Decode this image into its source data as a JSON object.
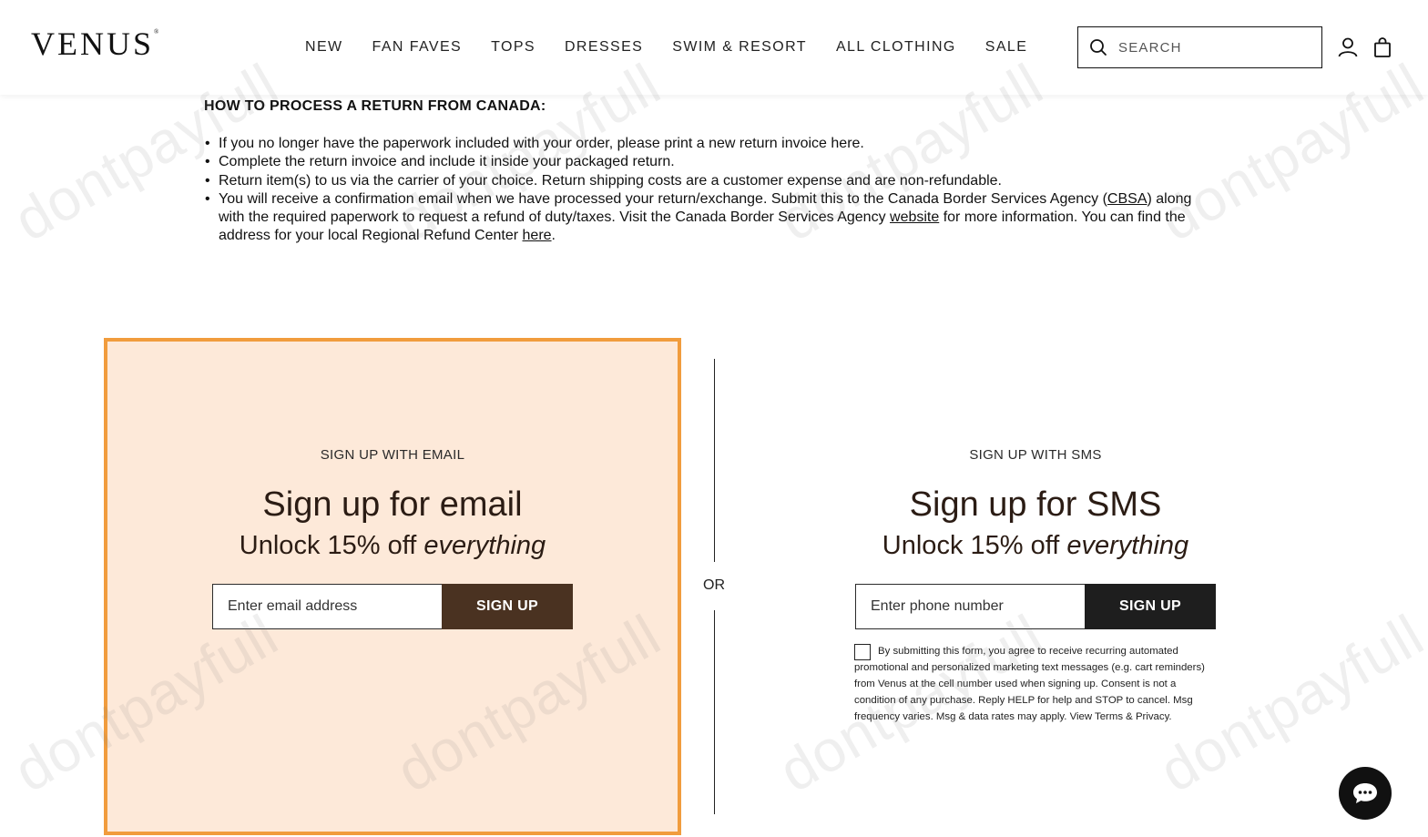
{
  "header": {
    "logo": "VENUS",
    "logo_mark": "®",
    "nav": [
      "NEW",
      "FAN FAVES",
      "TOPS",
      "DRESSES",
      "SWIM & RESORT",
      "ALL CLOTHING",
      "SALE"
    ],
    "search_placeholder": "SEARCH",
    "icons": [
      "search-icon",
      "account-icon",
      "shopping-bag-icon"
    ]
  },
  "returns": {
    "heading": "HOW TO PROCESS A RETURN FROM CANADA:",
    "item1": "If you no longer have the paperwork included with your order, please print a new return invoice here.",
    "item2": "Complete the return invoice and include it inside your packaged return.",
    "item3": "Return item(s) to us via the carrier of your choice. Return shipping costs are a customer expense and are non-refundable.",
    "item4_a": "You will receive a confirmation email when we have processed your return/exchange. Submit this to the Canada Border Services Agency (",
    "item4_link1": "CBSA",
    "item4_b": ") along with the required paperwork to request a refund of duty/taxes. Visit the Canada Border Services Agency ",
    "item4_link2": "website",
    "item4_c": " for more information. You can find the address for your local Regional Refund Center ",
    "item4_link3": "here",
    "item4_d": "."
  },
  "email_signup": {
    "kicker": "SIGN UP WITH EMAIL",
    "title": "Sign up for email",
    "subtitle_lead": "Unlock 15% off ",
    "subtitle_em": "everything",
    "input_placeholder": "Enter email address",
    "button": "SIGN UP",
    "card_bg": "#fde9d9",
    "card_border": "#f19c3d",
    "button_bg": "#4a3221"
  },
  "divider": {
    "label": "OR"
  },
  "sms_signup": {
    "kicker": "SIGN UP WITH SMS",
    "title": "Sign up for SMS",
    "subtitle_lead": "Unlock 15% off ",
    "subtitle_em": "everything",
    "input_placeholder": "Enter phone number",
    "button": "SIGN UP",
    "button_bg": "#1e1e1e",
    "consent": "By submitting this form, you agree to receive recurring automated promotional and personalized marketing text messages (e.g. cart reminders) from Venus at the cell number used when signing up. Consent is not a condition of any purchase. Reply HELP for help and STOP to cancel. Msg frequency varies. Msg & data rates may apply. View Terms & Privacy.",
    "consent_checked": false
  },
  "chat": {
    "icon": "chat-icon"
  },
  "watermark": "dontpayfull"
}
